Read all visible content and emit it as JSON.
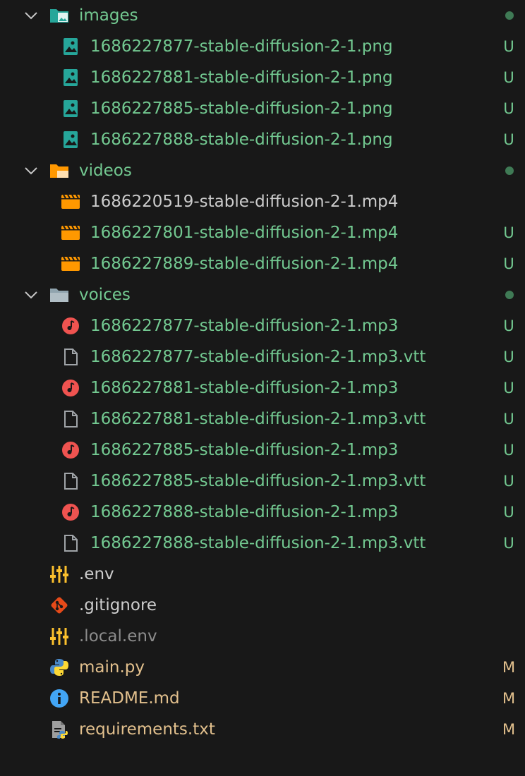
{
  "explorer": {
    "folders": [
      {
        "name": "images",
        "icon": "image-folder-icon",
        "files": [
          {
            "name": "1686227877-stable-diffusion-2-1.png",
            "status": "U",
            "icon": "image-file-icon"
          },
          {
            "name": "1686227881-stable-diffusion-2-1.png",
            "status": "U",
            "icon": "image-file-icon"
          },
          {
            "name": "1686227885-stable-diffusion-2-1.png",
            "status": "U",
            "icon": "image-file-icon"
          },
          {
            "name": "1686227888-stable-diffusion-2-1.png",
            "status": "U",
            "icon": "image-file-icon"
          }
        ]
      },
      {
        "name": "videos",
        "icon": "video-folder-icon",
        "files": [
          {
            "name": "1686220519-stable-diffusion-2-1.mp4",
            "status": "",
            "icon": "video-file-icon"
          },
          {
            "name": "1686227801-stable-diffusion-2-1.mp4",
            "status": "U",
            "icon": "video-file-icon"
          },
          {
            "name": "1686227889-stable-diffusion-2-1.mp4",
            "status": "U",
            "icon": "video-file-icon"
          }
        ]
      },
      {
        "name": "voices",
        "icon": "folder-icon",
        "files": [
          {
            "name": "1686227877-stable-diffusion-2-1.mp3",
            "status": "U",
            "icon": "audio-file-icon"
          },
          {
            "name": "1686227877-stable-diffusion-2-1.mp3.vtt",
            "status": "U",
            "icon": "text-file-icon"
          },
          {
            "name": "1686227881-stable-diffusion-2-1.mp3",
            "status": "U",
            "icon": "audio-file-icon"
          },
          {
            "name": "1686227881-stable-diffusion-2-1.mp3.vtt",
            "status": "U",
            "icon": "text-file-icon"
          },
          {
            "name": "1686227885-stable-diffusion-2-1.mp3",
            "status": "U",
            "icon": "audio-file-icon"
          },
          {
            "name": "1686227885-stable-diffusion-2-1.mp3.vtt",
            "status": "U",
            "icon": "text-file-icon"
          },
          {
            "name": "1686227888-stable-diffusion-2-1.mp3",
            "status": "U",
            "icon": "audio-file-icon"
          },
          {
            "name": "1686227888-stable-diffusion-2-1.mp3.vtt",
            "status": "U",
            "icon": "text-file-icon"
          }
        ]
      }
    ],
    "root_files": [
      {
        "name": ".env",
        "status": "",
        "icon": "env-settings-icon"
      },
      {
        "name": ".gitignore",
        "status": "",
        "icon": "git-icon"
      },
      {
        "name": ".local.env",
        "status": "",
        "icon": "env-settings-icon"
      },
      {
        "name": "main.py",
        "status": "M",
        "icon": "python-icon"
      },
      {
        "name": "README.md",
        "status": "M",
        "icon": "info-icon"
      },
      {
        "name": "requirements.txt",
        "status": "M",
        "icon": "requirements-file-icon"
      }
    ],
    "colors": {
      "background": "#181818",
      "untracked": "#73c991",
      "modified": "#e2c08d",
      "default_text": "#cccccc",
      "ignored": "#8c8c8c",
      "folder_dot": "#3f7a55"
    }
  }
}
